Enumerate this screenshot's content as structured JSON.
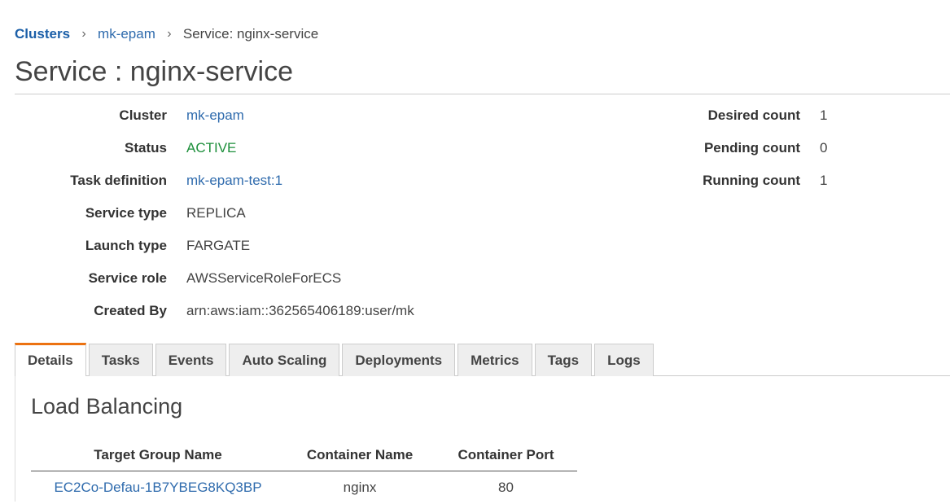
{
  "breadcrumb": {
    "root": "Clusters",
    "cluster": "mk-epam",
    "current": "Service: nginx-service",
    "separator": "›"
  },
  "page": {
    "title": "Service : nginx-service"
  },
  "summary": {
    "left": [
      {
        "label": "Cluster",
        "value": "mk-epam"
      },
      {
        "label": "Status",
        "value": "ACTIVE"
      },
      {
        "label": "Task definition",
        "value": "mk-epam-test:1"
      },
      {
        "label": "Service type",
        "value": "REPLICA"
      },
      {
        "label": "Launch type",
        "value": "FARGATE"
      },
      {
        "label": "Service role",
        "value": "AWSServiceRoleForECS"
      },
      {
        "label": "Created By",
        "value": "arn:aws:iam::362565406189:user/mk"
      }
    ],
    "right": [
      {
        "label": "Desired count",
        "value": "1"
      },
      {
        "label": "Pending count",
        "value": "0"
      },
      {
        "label": "Running count",
        "value": "1"
      }
    ]
  },
  "tabs": [
    {
      "label": "Details",
      "selected": true
    },
    {
      "label": "Tasks"
    },
    {
      "label": "Events"
    },
    {
      "label": "Auto Scaling"
    },
    {
      "label": "Deployments"
    },
    {
      "label": "Metrics"
    },
    {
      "label": "Tags"
    },
    {
      "label": "Logs"
    }
  ],
  "load_balancing": {
    "title": "Load Balancing",
    "columns": [
      "Target Group Name",
      "Container Name",
      "Container Port"
    ],
    "rows": [
      [
        "EC2Co-Defau-1B7YBEG8KQ3BP",
        "nginx",
        "80"
      ]
    ]
  },
  "colors": {
    "link": "#2f6bad",
    "breadcrumb_root": "#1b5fa8",
    "status_active": "#1d8f3b",
    "tab_accent": "#ec7211"
  }
}
